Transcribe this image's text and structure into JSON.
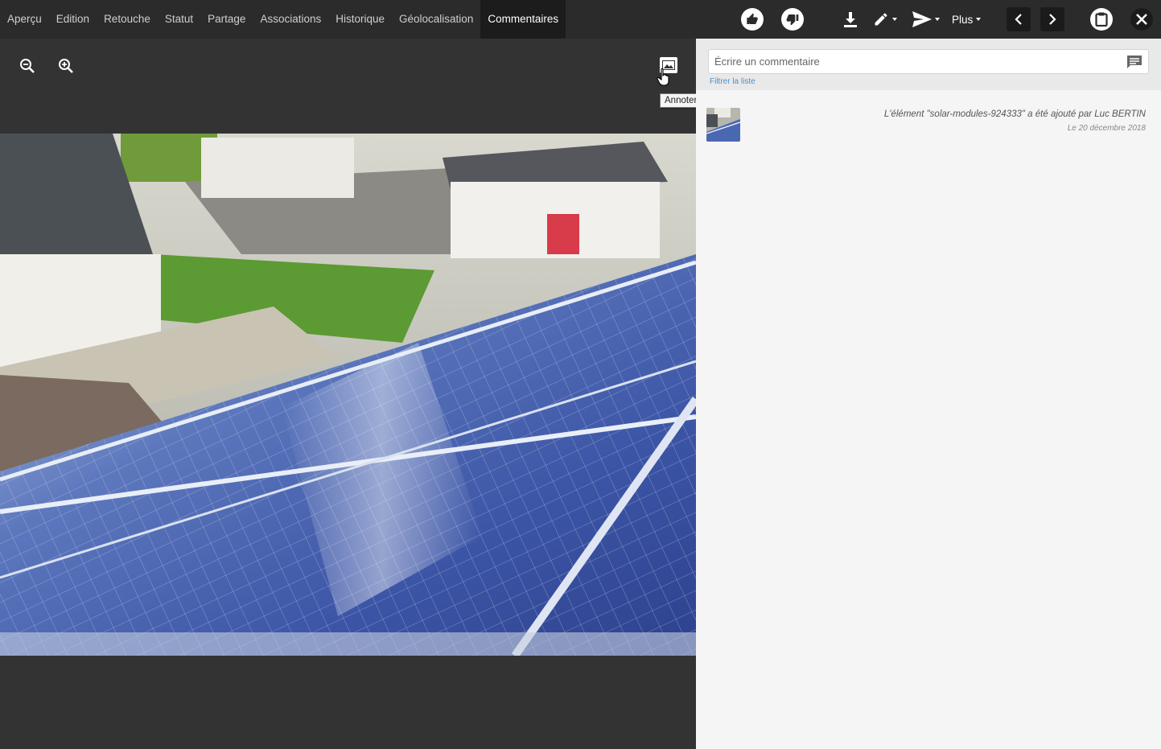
{
  "tabs": [
    {
      "label": "Aperçu"
    },
    {
      "label": "Edition"
    },
    {
      "label": "Retouche"
    },
    {
      "label": "Statut"
    },
    {
      "label": "Partage"
    },
    {
      "label": "Associations"
    },
    {
      "label": "Historique"
    },
    {
      "label": "Géolocalisation"
    },
    {
      "label": "Commentaires",
      "active": true
    }
  ],
  "toolbar": {
    "icons": [
      "thumbs-up-icon",
      "thumbs-down-icon",
      "download-icon",
      "edit-icon",
      "send-icon",
      "chevron-left-icon",
      "chevron-right-icon",
      "clipboard-icon",
      "close-icon"
    ],
    "plus_label": "Plus"
  },
  "viewer": {
    "zoom_out_icon": "zoom-out-icon",
    "zoom_in_icon": "zoom-in-icon",
    "annotate_icon": "annotate-image-icon",
    "tooltip": "Annoter le visuel"
  },
  "comments": {
    "input_placeholder": "Écrire un commentaire",
    "filter_label": "Filtrer la liste",
    "activity": [
      {
        "text": "L'élément \"solar-modules-924333\" a été ajouté par Luc BERTIN",
        "date": "Le 20 décembre 2018"
      }
    ]
  },
  "colors": {
    "topbar": "#2b2b2b",
    "active_tab": "#1c1c1c",
    "viewer_bg": "#333333",
    "panel_bg": "#f5f5f5",
    "link": "#4a8fcf"
  }
}
